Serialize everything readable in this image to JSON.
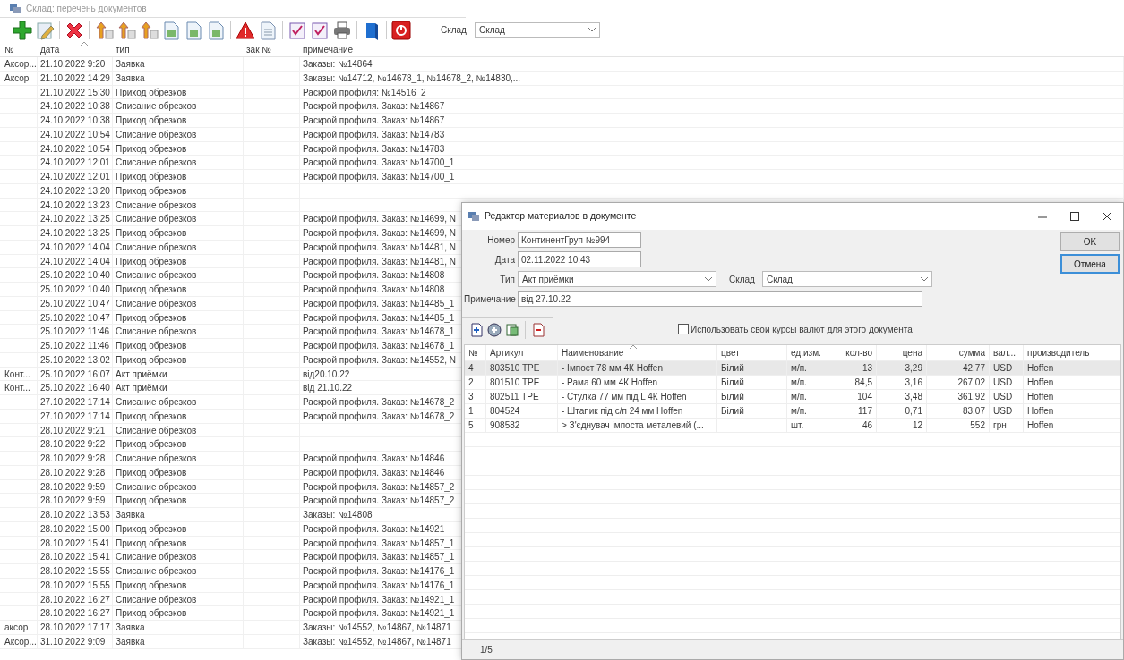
{
  "main_window": {
    "title": "Склад: перечень документов",
    "warehouse_label": "Склад",
    "warehouse_value": "Склад"
  },
  "documents": {
    "columns": [
      "№",
      "дата",
      "тип",
      "зак №",
      "примечание"
    ],
    "rows": [
      {
        "no": "Аксор...",
        "date": "21.10.2022 9:20",
        "type": "Заявка",
        "note": "Заказы: №14864"
      },
      {
        "no": "Аксор",
        "date": "21.10.2022 14:29",
        "type": "Заявка",
        "note": "Заказы: №14712, №14678_1, №14678_2, №14830,..."
      },
      {
        "date": "21.10.2022 15:30",
        "type": "Приход обрезков",
        "note": "Раскрой профиля: №14516_2"
      },
      {
        "date": "24.10.2022 10:38",
        "type": "Списание обрезков",
        "note": "Раскрой профиля. Заказ: №14867"
      },
      {
        "date": "24.10.2022 10:38",
        "type": "Приход обрезков",
        "note": "Раскрой профиля. Заказ: №14867"
      },
      {
        "date": "24.10.2022 10:54",
        "type": "Списание обрезков",
        "note": "Раскрой профиля. Заказ: №14783"
      },
      {
        "date": "24.10.2022 10:54",
        "type": "Приход обрезков",
        "note": "Раскрой профиля. Заказ: №14783"
      },
      {
        "date": "24.10.2022 12:01",
        "type": "Списание обрезков",
        "note": "Раскрой профиля. Заказ: №14700_1"
      },
      {
        "date": "24.10.2022 12:01",
        "type": "Приход обрезков",
        "note": "Раскрой профиля. Заказ: №14700_1"
      },
      {
        "date": "24.10.2022 13:20",
        "type": "Приход обрезков"
      },
      {
        "date": "24.10.2022 13:23",
        "type": "Списание обрезков"
      },
      {
        "date": "24.10.2022 13:25",
        "type": "Списание обрезков",
        "note": "Раскрой профиля. Заказ: №14699, N"
      },
      {
        "date": "24.10.2022 13:25",
        "type": "Приход обрезков",
        "note": "Раскрой профиля. Заказ: №14699, N"
      },
      {
        "date": "24.10.2022 14:04",
        "type": "Списание обрезков",
        "note": "Раскрой профиля. Заказ: №14481, N"
      },
      {
        "date": "24.10.2022 14:04",
        "type": "Приход обрезков",
        "note": "Раскрой профиля. Заказ: №14481, N"
      },
      {
        "date": "25.10.2022 10:40",
        "type": "Списание обрезков",
        "note": "Раскрой профиля. Заказ: №14808"
      },
      {
        "date": "25.10.2022 10:40",
        "type": "Приход обрезков",
        "note": "Раскрой профиля. Заказ: №14808"
      },
      {
        "date": "25.10.2022 10:47",
        "type": "Списание обрезков",
        "note": "Раскрой профиля. Заказ: №14485_1"
      },
      {
        "date": "25.10.2022 10:47",
        "type": "Приход обрезков",
        "note": "Раскрой профиля. Заказ: №14485_1"
      },
      {
        "date": "25.10.2022 11:46",
        "type": "Списание обрезков",
        "note": "Раскрой профиля. Заказ: №14678_1"
      },
      {
        "date": "25.10.2022 11:46",
        "type": "Приход обрезков",
        "note": "Раскрой профиля. Заказ: №14678_1"
      },
      {
        "date": "25.10.2022 13:02",
        "type": "Приход обрезков",
        "note": "Раскрой профиля. Заказ: №14552, N"
      },
      {
        "no": "Конт...",
        "date": "25.10.2022 16:07",
        "type": "Акт приёмки",
        "note": "від20.10.22"
      },
      {
        "no": "Конт...",
        "date": "25.10.2022 16:40",
        "type": "Акт приёмки",
        "note": "від 21.10.22"
      },
      {
        "date": "27.10.2022 17:14",
        "type": "Списание обрезков",
        "note": "Раскрой профиля. Заказ: №14678_2"
      },
      {
        "date": "27.10.2022 17:14",
        "type": "Приход обрезков",
        "note": "Раскрой профиля. Заказ: №14678_2"
      },
      {
        "date": "28.10.2022 9:21",
        "type": "Списание обрезков"
      },
      {
        "date": "28.10.2022 9:22",
        "type": "Приход обрезков"
      },
      {
        "date": "28.10.2022 9:28",
        "type": "Списание обрезков",
        "note": "Раскрой профиля. Заказ: №14846"
      },
      {
        "date": "28.10.2022 9:28",
        "type": "Приход обрезков",
        "note": "Раскрой профиля. Заказ: №14846"
      },
      {
        "date": "28.10.2022 9:59",
        "type": "Списание обрезков",
        "note": "Раскрой профиля. Заказ: №14857_2"
      },
      {
        "date": "28.10.2022 9:59",
        "type": "Приход обрезков",
        "note": "Раскрой профиля. Заказ: №14857_2"
      },
      {
        "date": "28.10.2022 13:53",
        "type": "Заявка",
        "note": "Заказы: №14808"
      },
      {
        "date": "28.10.2022 15:00",
        "type": "Приход обрезков",
        "note": "Раскрой профиля. Заказ: №14921"
      },
      {
        "date": "28.10.2022 15:41",
        "type": "Приход обрезков",
        "note": "Раскрой профиля. Заказ: №14857_1"
      },
      {
        "date": "28.10.2022 15:41",
        "type": "Списание обрезков",
        "note": "Раскрой профиля. Заказ: №14857_1"
      },
      {
        "date": "28.10.2022 15:55",
        "type": "Списание обрезков",
        "note": "Раскрой профиля. Заказ: №14176_1"
      },
      {
        "date": "28.10.2022 15:55",
        "type": "Приход обрезков",
        "note": "Раскрой профиля. Заказ: №14176_1"
      },
      {
        "date": "28.10.2022 16:27",
        "type": "Списание обрезков",
        "note": "Раскрой профиля. Заказ: №14921_1"
      },
      {
        "date": "28.10.2022 16:27",
        "type": "Приход обрезков",
        "note": "Раскрой профиля. Заказ: №14921_1"
      },
      {
        "no": "аксор",
        "date": "28.10.2022 17:17",
        "type": "Заявка",
        "note": "Заказы: №14552, №14867, №14871"
      },
      {
        "no": "Аксор...",
        "date": "31.10.2022 9:09",
        "type": "Заявка",
        "note": "Заказы: №14552, №14867, №14871"
      }
    ]
  },
  "dialog": {
    "title": "Редактор материалов в документе",
    "number": {
      "label": "Номер",
      "value": "КонтинентГруп №994"
    },
    "date": {
      "label": "Дата",
      "value": "02.11.2022 10:43"
    },
    "type": {
      "label": "Тип",
      "value": "Акт приёмки"
    },
    "warehouse": {
      "label": "Склад",
      "value": "Склад"
    },
    "note": {
      "label": "Примечание",
      "value": "від 27.10.22"
    },
    "buttons": [
      {
        "label": "OK",
        "focused": false
      },
      {
        "label": "Отмена",
        "focused": true
      }
    ],
    "own_rates": {
      "label": "Использовать свои курсы валют для этого документа",
      "checked": false
    },
    "table": {
      "columns": [
        "№",
        "Артикул",
        "Наименование",
        "цвет",
        "ед.изм.",
        "кол-во",
        "цена",
        "сумма",
        "вал...",
        "производитель"
      ],
      "rows": [
        {
          "selected": true,
          "cells": [
            "4",
            "803510 TPE",
            "- Імпост 78 мм 4К Hoffen",
            "Білий",
            "м/п.",
            "13",
            "3,29",
            "42,77",
            "USD",
            "Hoffen"
          ]
        },
        {
          "selected": false,
          "cells": [
            "2",
            "801510 TPE",
            "- Рама 60 мм 4К Hoffen",
            "Білий",
            "м/п.",
            "84,5",
            "3,16",
            "267,02",
            "USD",
            "Hoffen"
          ]
        },
        {
          "selected": false,
          "cells": [
            "3",
            "802511 TPE",
            "- Стулка 77 мм під L 4К Hoffen",
            "Білий",
            "м/п.",
            "104",
            "3,48",
            "361,92",
            "USD",
            "Hoffen"
          ]
        },
        {
          "selected": false,
          "cells": [
            "1",
            "804524",
            "- Штапик під с/п 24 мм Hoffen",
            "Білий",
            "м/п.",
            "117",
            "0,71",
            "83,07",
            "USD",
            "Hoffen"
          ]
        },
        {
          "selected": false,
          "cells": [
            "5",
            "908582",
            "> З'єднувач імпоста металевий (...",
            "",
            "шт.",
            "46",
            "12",
            "552",
            "грн",
            "Hoffen"
          ]
        }
      ]
    },
    "status": "1/5"
  }
}
